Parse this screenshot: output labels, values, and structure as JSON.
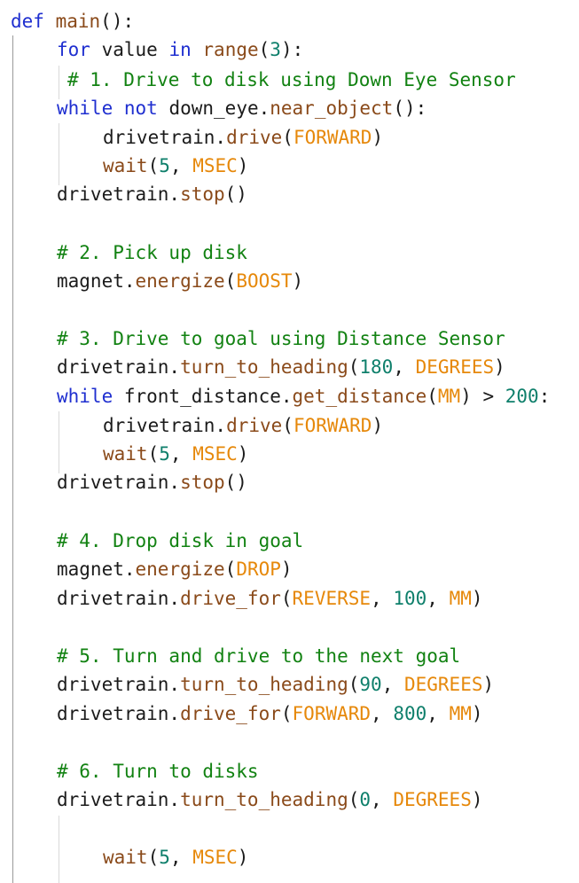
{
  "editor": {
    "lines": [
      [
        [
          "kw",
          "def"
        ],
        [
          "op",
          " "
        ],
        [
          "fn",
          "main"
        ],
        [
          "op",
          "():"
        ]
      ],
      [
        [
          "kw",
          "for"
        ],
        [
          "op",
          " value "
        ],
        [
          "kw",
          "in"
        ],
        [
          "op",
          " "
        ],
        [
          "fn",
          "range"
        ],
        [
          "op",
          "("
        ],
        [
          "num",
          "3"
        ],
        [
          "op",
          "):"
        ]
      ],
      [
        [
          "cm",
          "# 1. Drive to disk using Down Eye Sensor"
        ]
      ],
      [
        [
          "kw",
          "while"
        ],
        [
          "op",
          " "
        ],
        [
          "kw",
          "not"
        ],
        [
          "op",
          " down_eye."
        ],
        [
          "fn",
          "near_object"
        ],
        [
          "op",
          "():"
        ]
      ],
      [
        [
          "op",
          "drivetrain."
        ],
        [
          "fn",
          "drive"
        ],
        [
          "op",
          "("
        ],
        [
          "cst",
          "FORWARD"
        ],
        [
          "op",
          ")"
        ]
      ],
      [
        [
          "fn",
          "wait"
        ],
        [
          "op",
          "("
        ],
        [
          "num",
          "5"
        ],
        [
          "op",
          ", "
        ],
        [
          "cst",
          "MSEC"
        ],
        [
          "op",
          ")"
        ]
      ],
      [
        [
          "op",
          "drivetrain."
        ],
        [
          "fn",
          "stop"
        ],
        [
          "op",
          "()"
        ]
      ],
      [],
      [
        [
          "cm",
          "# 2. Pick up disk"
        ]
      ],
      [
        [
          "op",
          "magnet."
        ],
        [
          "fn",
          "energize"
        ],
        [
          "op",
          "("
        ],
        [
          "cst",
          "BOOST"
        ],
        [
          "op",
          ")"
        ]
      ],
      [],
      [
        [
          "cm",
          "# 3. Drive to goal using Distance Sensor"
        ]
      ],
      [
        [
          "op",
          "drivetrain."
        ],
        [
          "fn",
          "turn_to_heading"
        ],
        [
          "op",
          "("
        ],
        [
          "num",
          "180"
        ],
        [
          "op",
          ", "
        ],
        [
          "cst",
          "DEGREES"
        ],
        [
          "op",
          ")"
        ]
      ],
      [
        [
          "kw",
          "while"
        ],
        [
          "op",
          " front_distance."
        ],
        [
          "fn",
          "get_distance"
        ],
        [
          "op",
          "("
        ],
        [
          "cst",
          "MM"
        ],
        [
          "op",
          ") > "
        ],
        [
          "num",
          "200"
        ],
        [
          "op",
          ":"
        ]
      ],
      [
        [
          "op",
          "drivetrain."
        ],
        [
          "fn",
          "drive"
        ],
        [
          "op",
          "("
        ],
        [
          "cst",
          "FORWARD"
        ],
        [
          "op",
          ")"
        ]
      ],
      [
        [
          "fn",
          "wait"
        ],
        [
          "op",
          "("
        ],
        [
          "num",
          "5"
        ],
        [
          "op",
          ", "
        ],
        [
          "cst",
          "MSEC"
        ],
        [
          "op",
          ")"
        ]
      ],
      [
        [
          "op",
          "drivetrain."
        ],
        [
          "fn",
          "stop"
        ],
        [
          "op",
          "()"
        ]
      ],
      [],
      [
        [
          "cm",
          "# 4. Drop disk in goal"
        ]
      ],
      [
        [
          "op",
          "magnet."
        ],
        [
          "fn",
          "energize"
        ],
        [
          "op",
          "("
        ],
        [
          "cst",
          "DROP"
        ],
        [
          "op",
          ")"
        ]
      ],
      [
        [
          "op",
          "drivetrain."
        ],
        [
          "fn",
          "drive_for"
        ],
        [
          "op",
          "("
        ],
        [
          "cst",
          "REVERSE"
        ],
        [
          "op",
          ", "
        ],
        [
          "num",
          "100"
        ],
        [
          "op",
          ", "
        ],
        [
          "cst",
          "MM"
        ],
        [
          "op",
          ")"
        ]
      ],
      [],
      [
        [
          "cm",
          "# 5. Turn and drive to the next goal"
        ]
      ],
      [
        [
          "op",
          "drivetrain."
        ],
        [
          "fn",
          "turn_to_heading"
        ],
        [
          "op",
          "("
        ],
        [
          "num",
          "90"
        ],
        [
          "op",
          ", "
        ],
        [
          "cst",
          "DEGREES"
        ],
        [
          "op",
          ")"
        ]
      ],
      [
        [
          "op",
          "drivetrain."
        ],
        [
          "fn",
          "drive_for"
        ],
        [
          "op",
          "("
        ],
        [
          "cst",
          "FORWARD"
        ],
        [
          "op",
          ", "
        ],
        [
          "num",
          "800"
        ],
        [
          "op",
          ", "
        ],
        [
          "cst",
          "MM"
        ],
        [
          "op",
          ")"
        ]
      ],
      [],
      [
        [
          "cm",
          "# 6. Turn to disks"
        ]
      ],
      [
        [
          "op",
          "drivetrain."
        ],
        [
          "fn",
          "turn_to_heading"
        ],
        [
          "op",
          "("
        ],
        [
          "num",
          "0"
        ],
        [
          "op",
          ", "
        ],
        [
          "cst",
          "DEGREES"
        ],
        [
          "op",
          ")"
        ]
      ],
      [],
      [
        [
          "fn",
          "wait"
        ],
        [
          "op",
          "("
        ],
        [
          "num",
          "5"
        ],
        [
          "op",
          ", "
        ],
        [
          "cst",
          "MSEC"
        ],
        [
          "op",
          ")"
        ]
      ]
    ]
  }
}
